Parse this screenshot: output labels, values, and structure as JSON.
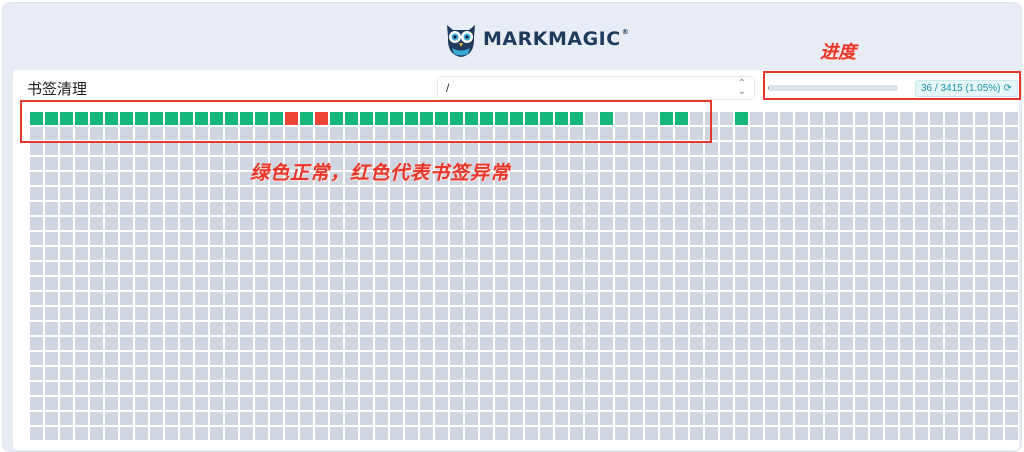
{
  "app": {
    "logo_text": "MARKMAGIC",
    "logo_mark": "®"
  },
  "annotations": {
    "progress_label": "进度",
    "legend_text": "绿色正常，红色代表书签异常"
  },
  "panel": {
    "title": "书签清理",
    "path_value": "/",
    "progress": {
      "text": "36 / 3415 (1.05%)",
      "fraction": 0.0105,
      "spinner": "⟳"
    }
  },
  "grid": {
    "columns": 66,
    "rows": 22,
    "ok_cells": [
      0,
      1,
      2,
      3,
      4,
      5,
      6,
      7,
      8,
      9,
      10,
      11,
      12,
      13,
      14,
      15,
      16,
      18,
      20,
      21,
      22,
      23,
      24,
      25,
      26,
      27,
      28,
      29,
      30,
      31,
      32,
      33,
      34,
      35,
      36,
      38,
      42,
      43,
      47
    ],
    "bad_cells": [
      17,
      19
    ],
    "colors": {
      "ok": "#16b77a",
      "bad": "#ec4436",
      "pending": "#cfd6e1"
    }
  }
}
